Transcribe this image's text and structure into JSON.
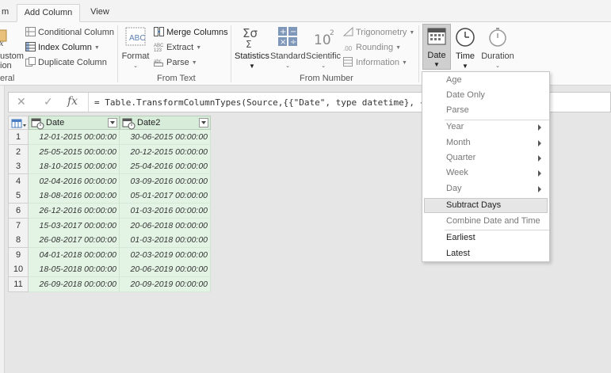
{
  "tabs": [
    {
      "label": "m"
    },
    {
      "label": "Add Column"
    },
    {
      "label": "View"
    }
  ],
  "ribbon": {
    "general": {
      "custom_line1": "ustom",
      "custom_line2": "ion",
      "group_label": "eral",
      "conditional_column": "Conditional Column",
      "index_column": "Index Column",
      "duplicate_column": "Duplicate Column"
    },
    "from_text": {
      "format": "Format",
      "merge_columns": "Merge Columns",
      "extract": "Extract",
      "parse": "Parse",
      "group_label": "From Text"
    },
    "from_number": {
      "statistics": "Statistics",
      "standard": "Standard",
      "scientific": "Scientific",
      "trigonometry": "Trigonometry",
      "rounding": "Rounding",
      "information": "Information",
      "group_label": "From Number"
    },
    "from_date": {
      "date": "Date",
      "time": "Time",
      "duration": "Duration"
    }
  },
  "formula_bar": {
    "fx": "fx",
    "cancel": "✕",
    "confirm": "✓",
    "formula": "= Table.TransformColumnTypes(Source,{{\"Date\", type datetime}, {\"Date2\","
  },
  "grid": {
    "columns": [
      "Date",
      "Date2"
    ],
    "rows": [
      {
        "n": "1",
        "date": "12-01-2015 00:00:00",
        "date2": "30-06-2015 00:00:00"
      },
      {
        "n": "2",
        "date": "25-05-2015 00:00:00",
        "date2": "20-12-2015 00:00:00"
      },
      {
        "n": "3",
        "date": "18-10-2015 00:00:00",
        "date2": "25-04-2016 00:00:00"
      },
      {
        "n": "4",
        "date": "02-04-2016 00:00:00",
        "date2": "03-09-2016 00:00:00"
      },
      {
        "n": "5",
        "date": "18-08-2016 00:00:00",
        "date2": "05-01-2017 00:00:00"
      },
      {
        "n": "6",
        "date": "26-12-2016 00:00:00",
        "date2": "01-03-2016 00:00:00"
      },
      {
        "n": "7",
        "date": "15-03-2017 00:00:00",
        "date2": "20-06-2018 00:00:00"
      },
      {
        "n": "8",
        "date": "26-08-2017 00:00:00",
        "date2": "01-03-2018 00:00:00"
      },
      {
        "n": "9",
        "date": "04-01-2018 00:00:00",
        "date2": "02-03-2019 00:00:00"
      },
      {
        "n": "10",
        "date": "18-05-2018 00:00:00",
        "date2": "20-06-2019 00:00:00"
      },
      {
        "n": "11",
        "date": "26-09-2018 00:00:00",
        "date2": "20-09-2019 00:00:00"
      }
    ]
  },
  "date_menu": {
    "age": "Age",
    "date_only": "Date Only",
    "parse": "Parse",
    "year": "Year",
    "month": "Month",
    "quarter": "Quarter",
    "week": "Week",
    "day": "Day",
    "subtract_days": "Subtract Days",
    "combine_date_time": "Combine Date and Time",
    "earliest": "Earliest",
    "latest": "Latest"
  },
  "colors": {
    "header_green": "#d7ecd9",
    "cell_green": "#e3f3e4",
    "ribbon_bg": "#fafafa",
    "icon_blue": "#4a7ec2"
  }
}
